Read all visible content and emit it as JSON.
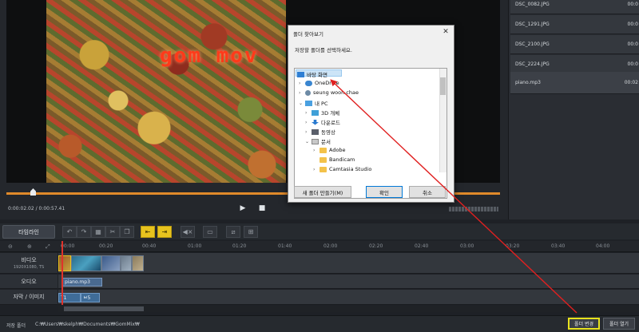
{
  "preview": {
    "overlay_text": "gom mov",
    "time": "0:00:02.02 / 0:00:57.41",
    "play_icon": "▶",
    "stop_icon": "■"
  },
  "file_list": [
    {
      "name": "DSC_0082.JPG",
      "duration": "00:0"
    },
    {
      "name": "DSC_1291.JPG",
      "duration": "00:0"
    },
    {
      "name": "DSC_2100.JPG",
      "duration": "00:0"
    },
    {
      "name": "DSC_2224.JPG",
      "duration": "00:0"
    },
    {
      "name": "piano.mp3",
      "duration": "00:02"
    }
  ],
  "toolbar": {
    "timeline_tab": "타임라인"
  },
  "ruler": {
    "ticks": [
      "00:00",
      "00:40",
      "01:20",
      "02:00",
      "02:40",
      "03:20",
      "04:00"
    ],
    "ticks_b": [
      "00:20",
      "01:00",
      "01:40",
      "02:20",
      "03:00",
      "03:40"
    ]
  },
  "tracks": {
    "video_label": "비디오",
    "video_res": "1920X1080, TS",
    "audio_label": "오디오",
    "audio_clip": "piano.mp3",
    "subtitle_label": "자막 / 이미지",
    "sub_clip_1": "T1",
    "sub_clip_2": "ㅂ5"
  },
  "status": {
    "folder_label": "저장 폴더",
    "folder_path": "C:₩Users₩skelph₩Documents₩GomMix₩",
    "change_folder": "폴더 변경",
    "open_folder": "폴더 열기"
  },
  "dialog": {
    "title": "폴더 찾아보기",
    "close": "✕",
    "instruction": "저장할 폴더를 선택하세요.",
    "tree": [
      {
        "label": "바탕 화면",
        "icon": "desktop-icon"
      },
      {
        "label": "OneDrive",
        "icon": "cloud-icon"
      },
      {
        "label": "seung woon chae",
        "icon": "user-icon"
      },
      {
        "label": "내 PC",
        "icon": "pc-icon"
      },
      {
        "label": "3D 개체",
        "icon": "3d-icon"
      },
      {
        "label": "다운로드",
        "icon": "download-icon"
      },
      {
        "label": "동영상",
        "icon": "video-icon"
      },
      {
        "label": "문서",
        "icon": "document-icon"
      },
      {
        "label": "Adobe",
        "icon": "folder-icon"
      },
      {
        "label": "Bandicam",
        "icon": "folder-icon"
      },
      {
        "label": "Camtasia Studio",
        "icon": "folder-icon"
      }
    ],
    "new_folder_btn": "새 폴더 만들기(M)",
    "ok_btn": "확인",
    "cancel_btn": "취소"
  },
  "colors": {
    "accent_orange": "#e08a2a",
    "highlight_yellow": "#e7e21e",
    "arrow_red": "#e02020"
  }
}
